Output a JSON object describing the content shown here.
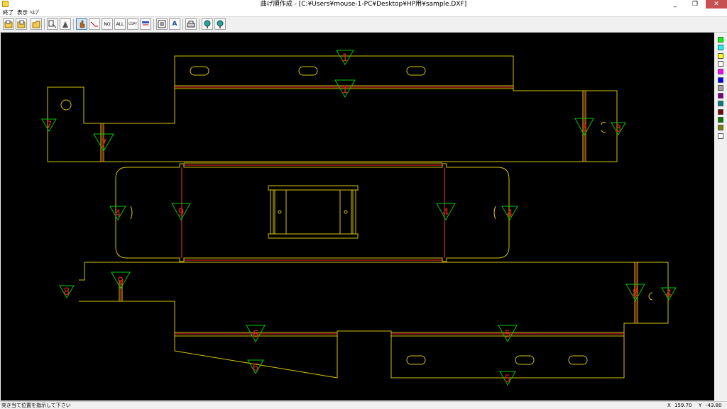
{
  "window": {
    "title": "曲げ順作成 - [C:¥Users¥mouse-1-PC¥Desktop¥HP用¥sample.DXF]",
    "minimize": "_",
    "restore": "❐",
    "close": "✕"
  },
  "menu": [
    "終了",
    "表示",
    "ﾍﾙﾌﾟ"
  ],
  "toolbar": {
    "buttons": [
      {
        "name": "open-file",
        "label": ""
      },
      {
        "name": "save-file",
        "label": ""
      },
      {
        "name": "open-folder",
        "label": ""
      },
      {
        "name": "read-dxf",
        "label": ""
      },
      {
        "name": "punch",
        "label": ""
      },
      {
        "name": "select-bend",
        "label": ""
      },
      {
        "name": "bend-line",
        "label": ""
      },
      {
        "name": "number-bend",
        "label": "NO"
      },
      {
        "name": "all-bend",
        "label": "ALL"
      },
      {
        "name": "copy-bend",
        "label": "COPY"
      },
      {
        "name": "delete-bend",
        "label": ""
      },
      {
        "name": "list",
        "label": ""
      },
      {
        "name": "edit",
        "label": "A"
      },
      {
        "name": "print",
        "label": ""
      },
      {
        "name": "zoom-in",
        "label": ""
      },
      {
        "name": "zoom-out",
        "label": ""
      }
    ]
  },
  "bend_markers": {
    "m1a": "1",
    "m1b": "1",
    "m3a": "3",
    "m3b": "3",
    "m4a": "4",
    "m4b": "4",
    "m4c": "4",
    "m4d": "4",
    "m5a": "5",
    "m5b": "5",
    "m6a": "6",
    "m6b": "6",
    "m7a": "7",
    "m7b": "7",
    "m8a": "8",
    "m8b": "8",
    "m9a": "9",
    "m9b": "9"
  },
  "palette": {
    "colors": [
      "#00ff00",
      "#00ffff",
      "#ffff00",
      "#ffffff",
      "#ff00ff",
      "#0000ff",
      "#a0a0a0",
      "#800080",
      "#008080",
      "#800000",
      "#008000",
      "#808000",
      "#ffffff"
    ]
  },
  "status": {
    "message": "突き当て位置を指示して下さい",
    "x_label": "X",
    "x_value": "159.70",
    "y_label": "Y",
    "y_value": "-43.80"
  }
}
